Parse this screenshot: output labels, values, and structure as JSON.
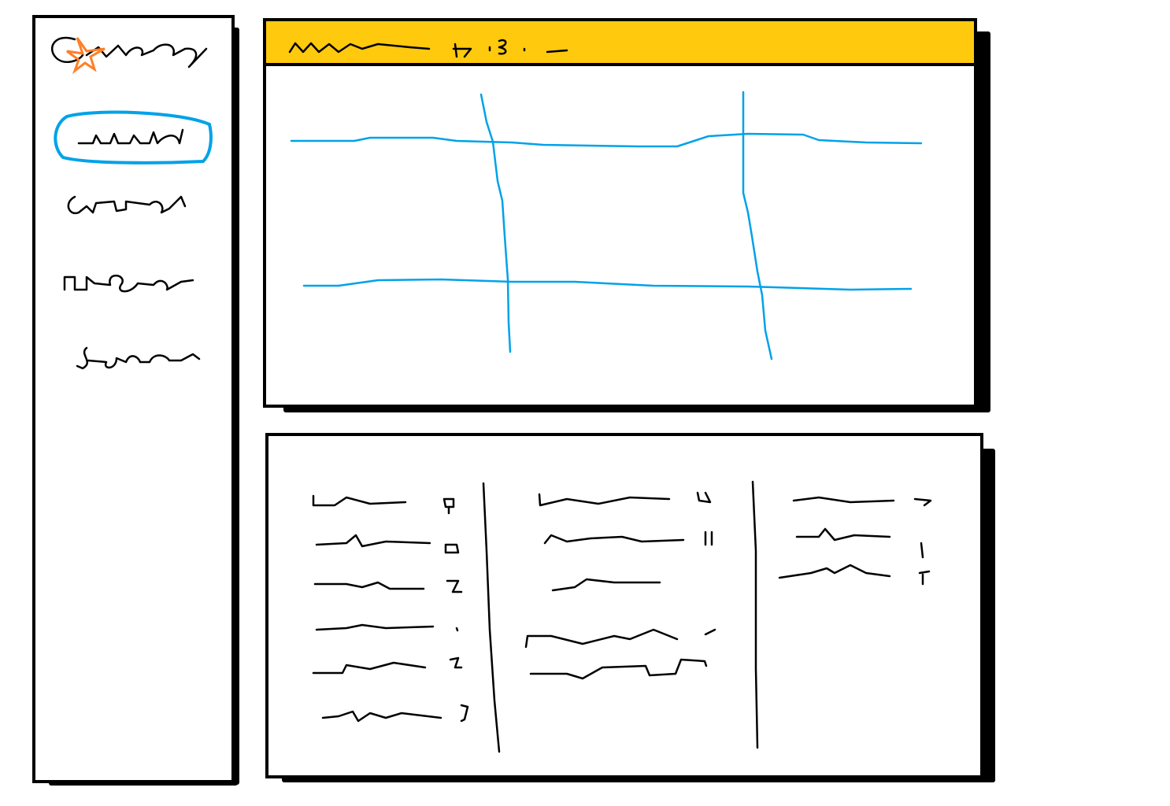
{
  "colors": {
    "ink": "#000000",
    "header": "#FFC90E",
    "accent": "#00A2E8",
    "logo_star": "#FF7F27"
  },
  "sidebar": {
    "active_index": 0,
    "item_count": 4
  },
  "map_panel": {
    "horizontal_roads": 2,
    "vertical_roads": 2
  },
  "stats_panel": {
    "columns": 3
  }
}
